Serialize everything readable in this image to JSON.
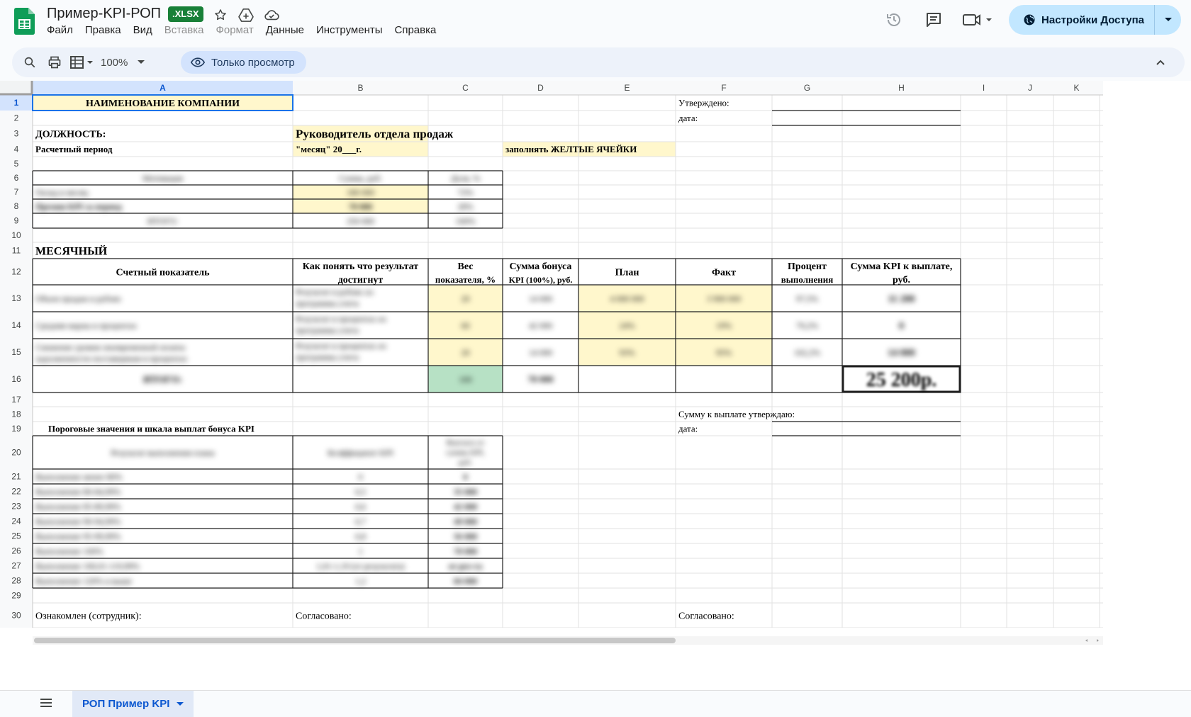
{
  "app": {
    "doc_title": "Пример-KPI-РОП",
    "file_badge": ".XLSX",
    "menu": [
      "Файл",
      "Правка",
      "Вид",
      "Вставка",
      "Формат",
      "Данные",
      "Инструменты",
      "Справка"
    ],
    "menu_disabled": [
      false,
      false,
      false,
      true,
      true,
      false,
      false,
      false
    ],
    "share_label": "Настройки Доступа",
    "zoom": "100%",
    "view_only_label": "Только просмотр",
    "sheet_tab": "РОП Пример KPI",
    "colors": {
      "accent_blue": "#0b57d0",
      "share_bg": "#c2e7ff",
      "yellow_cell": "#fff7cc",
      "green_cell": "#b7e1c5",
      "header_selected": "#d3e3fd"
    }
  },
  "sheet": {
    "columns": [
      "A",
      "B",
      "C",
      "D",
      "E",
      "F",
      "G",
      "H",
      "I",
      "J",
      "K"
    ],
    "rows": [
      "1",
      "2",
      "3",
      "4",
      "5",
      "6",
      "7",
      "8",
      "9",
      "10",
      "11",
      "12",
      "13",
      "14",
      "15",
      "16",
      "17",
      "18",
      "19",
      "20",
      "21",
      "22",
      "23",
      "24",
      "25",
      "26",
      "27",
      "28",
      "29",
      "30"
    ],
    "cells": {
      "a1": "НАИМЕНОВАНИЕ КОМПАНИИ",
      "f1": "Утверждено:",
      "f2": "дата:",
      "a3": "ДОЛЖНОСТЬ:",
      "b3": "Руководитель отдела продаж",
      "a4": "Расчетный период",
      "b4": "\"месяц\" 20___г.",
      "d4": "заполнять ЖЕЛТЫЕ ЯЧЕЙКИ",
      "a6": "Мотивация",
      "b6": "Сумма, руб.",
      "c6": "Доля, %",
      "a7": "Оклад в месяц",
      "b7": "180 000",
      "c7": "72%",
      "a8": "Премия KPI за период",
      "b8": "70 000",
      "c8": "28%",
      "a9": "ИТОГО:",
      "b9": "250 000",
      "c9": "100%",
      "a11": "МЕСЯЧНЫЙ",
      "a12": "Счетный показатель",
      "b12_1": "Как понять что результат",
      "b12_2": "достигнут",
      "c12_1": "Вес",
      "c12_2": "показателя, %",
      "d12_1": "Сумма бонуса",
      "d12_2": "KPI (100%), руб.",
      "e12": "План",
      "f12": "Факт",
      "g12_1": "Процент",
      "g12_2": "выполнения",
      "h12_1": "Сумма KPI к выплате,",
      "h12_2": "руб.",
      "a13": "Объем продаж в рублях",
      "b13_1": "Результат в рублях из",
      "b13_2": "программы учета",
      "c13": "20",
      "d13": "14 000",
      "e13": "4 000 000",
      "f13": "3 900 000",
      "g13": "97,5%",
      "h13": "11 200",
      "a14": "Средняя маржа в процентах",
      "b14_1": "Результат в процентах из",
      "b14_2": "программы учета",
      "c14": "60",
      "d14": "42 000",
      "e14": "24%",
      "f14": "19%",
      "g14": "79,2%",
      "h14": "0",
      "a15_1": "Снижение уровня своевременной оплаты",
      "a15_2": "задолженности поставщикам в процентах",
      "b15_1": "Результат в процентах из",
      "b15_2": "программы учета",
      "c15": "20",
      "d15": "14 000",
      "e15": "93%",
      "f15": "95%",
      "g15": "102,2%",
      "h15": "14 000",
      "a16": "ИТОГО:",
      "c16": "100",
      "d16": "70 000",
      "h16": "25 200р.",
      "f18": "Сумму к выплате утверждаю:",
      "a19": "Пороговые значения и шкала выплат бонуса KPI",
      "f19": "дата:",
      "a20": "Результат выполнения плана",
      "b20": "Коэффициент KPI",
      "c20_1": "Выплата от",
      "c20_2": "суммы KPI,",
      "c20_3": "руб.",
      "a21": "Выполнение менее 80%",
      "b21": "0",
      "c21": "0",
      "a22": "Выполнение 80-84,99%",
      "b22": "0,5",
      "c22": "35 000",
      "a23": "Выполнение 85-89,99%",
      "b23": "0,6",
      "c23": "42 000",
      "a24": "Выполнение 90-94,99%",
      "b24": "0,7",
      "c24": "49 000",
      "a25": "Выполнение 95-99,99%",
      "b25": "0,8",
      "c25": "56 000",
      "a26": "Выполнение 100%",
      "b26": "1",
      "c26": "70 000",
      "a27": "Выполнение 100,01-119,99%",
      "b27": "1,01-1,19 (от результата)",
      "c27": "от рез-та",
      "a28": "Выполнение 120% и выше",
      "b28": "1,2",
      "c28": "84 000",
      "a30": "Ознакомлен (сотрудник):",
      "b30": "Согласовано:",
      "f30": "Согласовано:"
    }
  }
}
